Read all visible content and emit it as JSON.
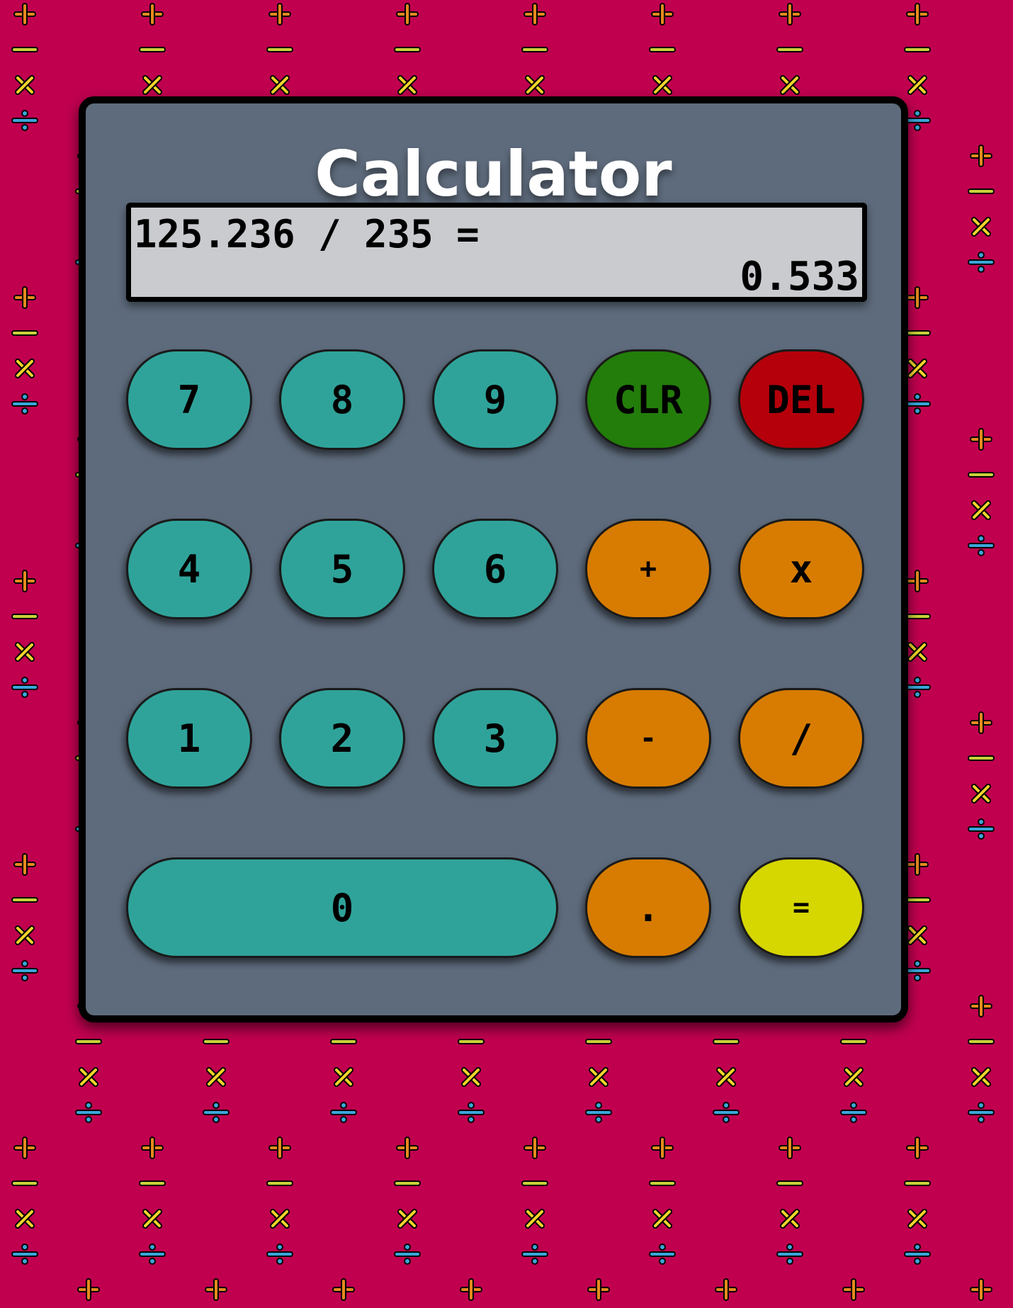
{
  "calculator": {
    "title": "Calculator",
    "display": {
      "expression": "125.236 / 235 =",
      "result": "0.533"
    },
    "keys": [
      {
        "label": "7",
        "type": "num",
        "name": "key-7"
      },
      {
        "label": "8",
        "type": "num",
        "name": "key-8"
      },
      {
        "label": "9",
        "type": "num",
        "name": "key-9"
      },
      {
        "label": "CLR",
        "type": "clr",
        "name": "clear-button"
      },
      {
        "label": "DEL",
        "type": "del",
        "name": "delete-button"
      },
      {
        "label": "4",
        "type": "num",
        "name": "key-4"
      },
      {
        "label": "5",
        "type": "num",
        "name": "key-5"
      },
      {
        "label": "6",
        "type": "num",
        "name": "key-6"
      },
      {
        "label": "+",
        "type": "op",
        "name": "add-button"
      },
      {
        "label": "x",
        "type": "op",
        "name": "multiply-button"
      },
      {
        "label": "1",
        "type": "num",
        "name": "key-1"
      },
      {
        "label": "2",
        "type": "num",
        "name": "key-2"
      },
      {
        "label": "3",
        "type": "num",
        "name": "key-3"
      },
      {
        "label": "-",
        "type": "op",
        "name": "subtract-button"
      },
      {
        "label": "/",
        "type": "op",
        "name": "divide-button"
      },
      {
        "label": "0",
        "type": "num",
        "name": "key-0"
      },
      {
        "label": ".",
        "type": "op",
        "name": "decimal-button"
      },
      {
        "label": "=",
        "type": "eq",
        "name": "equals-button"
      }
    ]
  },
  "colors": {
    "background": "#c0004f",
    "body": "#5e6b7c",
    "display": "#c9cbcf",
    "number_key": "#2fa39a",
    "clear_key": "#237d0a",
    "delete_key": "#b5000b",
    "operator_key": "#d77c00",
    "equals_key": "#d6d600",
    "pattern_plus": "#e58a1e",
    "pattern_minus": "#c9d13a",
    "pattern_times": "#f2d52b",
    "pattern_divide": "#3aa6d9"
  },
  "background_pattern": {
    "icons": [
      "plus-icon",
      "minus-icon",
      "times-icon",
      "divide-icon"
    ]
  }
}
